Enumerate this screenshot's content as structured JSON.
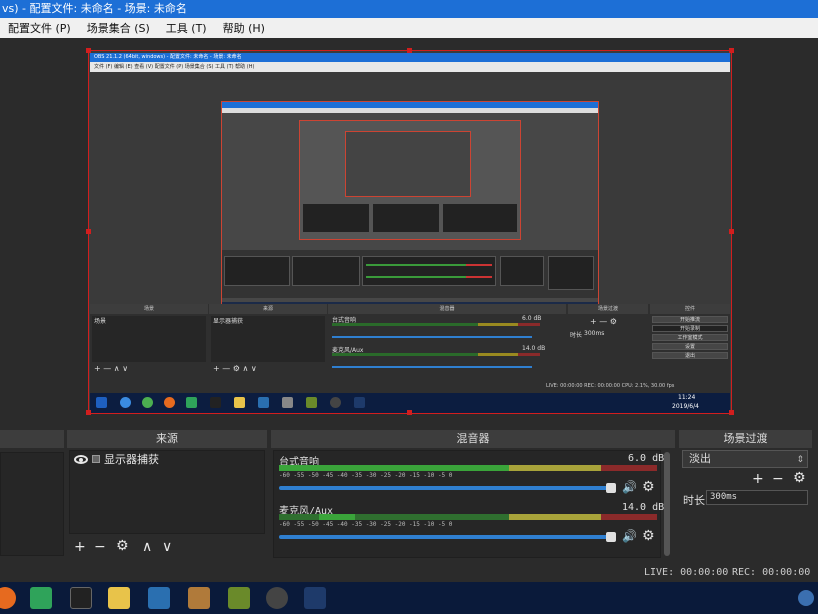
{
  "window": {
    "title": "vs) - 配置文件: 未命名 - 场景: 未命名"
  },
  "menu": {
    "items": [
      "配置文件 (P)",
      "场景集合 (S)",
      "工具 (T)",
      "帮助 (H)"
    ]
  },
  "nested": {
    "title": "OBS 21.1.2 (64bit, windows) - 配置文件: 未命名 - 场景: 未命名",
    "menu": "文件 (F)   编辑 (E)   查看 (V)   配置文件 (P)   场景集合 (S)   工具 (T)   帮助 (H)",
    "panels": {
      "scenes": "场景",
      "sources": "来源",
      "mixer": "混音器",
      "transitions": "场景过渡",
      "controls": "控件"
    },
    "scene_item": "场景",
    "source_item": "显示器捕获",
    "desktop_audio": "台式音响",
    "desktop_db": "6.0 dB",
    "mic": "麦克风/Aux",
    "mic_db": "14.0 dB",
    "duration_label": "时长",
    "duration_value": "300ms",
    "controls": [
      "开始推流",
      "开始录制",
      "工作室模式",
      "设置",
      "退出"
    ],
    "status": "LIVE: 00:00:00    REC: 00:00:00    CPU: 2.1%, 30.00 fps",
    "clock_time": "11:24",
    "clock_date": "2019/6/4"
  },
  "panels": {
    "sources_title": "来源",
    "mixer_title": "混音器",
    "transitions_title": "场景过渡"
  },
  "sources": {
    "items": [
      {
        "label": "显示器捕获"
      }
    ]
  },
  "mixer": {
    "channels": [
      {
        "name": "台式音响",
        "db": "6.0 dB",
        "volume": 0.95
      },
      {
        "name": "麦克风/Aux",
        "db": "14.0 dB",
        "volume": 0.95
      }
    ],
    "ticks": "-60  -55  -50  -45  -40  -35  -30  -25  -20  -15  -10   -5    0"
  },
  "transitions": {
    "selected": "淡出",
    "duration_label": "时长",
    "duration_value": "300ms"
  },
  "status": {
    "live": "LIVE: 00:00:00",
    "rec": "REC: 00:00:00"
  },
  "colors": {
    "accent": "#1d6fd6",
    "selection": "#d21e1e",
    "meter_green": "#3aa43a",
    "meter_yellow": "#a8a33a",
    "meter_red": "#8b2a2a"
  }
}
